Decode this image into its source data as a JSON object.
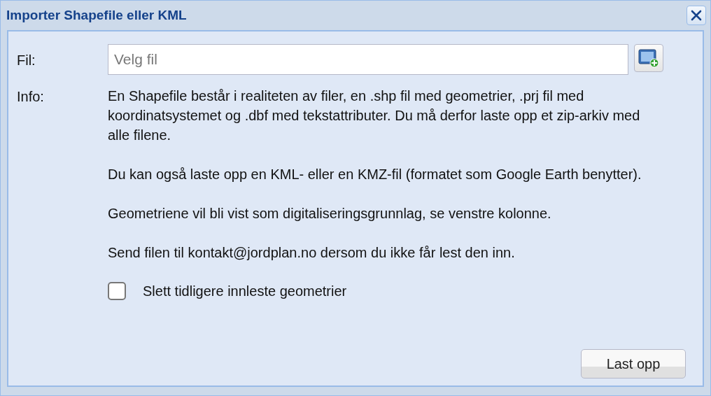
{
  "window": {
    "title": "Importer Shapefile eller KML"
  },
  "file": {
    "label": "Fil:",
    "placeholder": "Velg fil"
  },
  "info": {
    "label": "Info:",
    "paragraphs": [
      "En Shapefile består i realiteten av filer, en .shp fil med geometrier, .prj fil med koordinatsystemet og .dbf med tekstattributer. Du må derfor laste opp et zip-arkiv med alle filene.",
      "Du kan også laste opp en KML- eller en KMZ-fil (formatet som Google Earth benytter).",
      "Geometriene vil bli vist som digitaliseringsgrunnlag, se venstre kolonne.",
      "Send filen til kontakt@jordplan.no dersom du ikke får lest den inn."
    ]
  },
  "option": {
    "label": "Slett tidligere innleste geometrier",
    "checked": false
  },
  "buttons": [
    "Last opp"
  ]
}
